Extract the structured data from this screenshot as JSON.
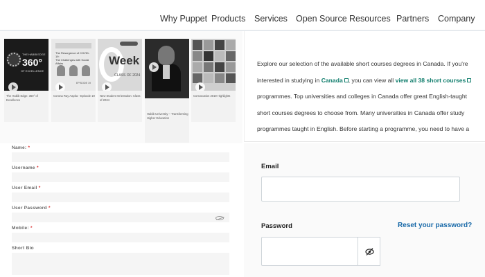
{
  "nav": {
    "items": [
      "Why Puppet",
      "Products",
      "Services",
      "Open Source",
      "Resources",
      "Partners",
      "Company"
    ]
  },
  "videos": [
    {
      "caption": "The Habib Edge: 360° of Excellence",
      "thumb_text": [
        "THE HABIB EDGE",
        "360°",
        "OF EXCELLENCE"
      ]
    },
    {
      "caption": "Corona Ray Aapka - Episode 19",
      "thumb_text": [
        "The Resurgence of COVID-19:",
        "The Challenges with Social Affairs",
        "EPISODE 19"
      ]
    },
    {
      "caption": "New Student Orientation: Class of 2024",
      "thumb_text": [
        "Week",
        "CLASS OF 2024"
      ]
    },
    {
      "caption": "Habib University – Transforming Higher Education"
    },
    {
      "caption": "Convocation 2019 Highlights"
    }
  ],
  "intro": {
    "text_a": "Explore our selection of the available short courses degrees in Canada. If you're interested in studying in ",
    "link_country": "Canada",
    "text_b": ", you can view all ",
    "link_view_all": "view all 38 short courses",
    "text_c": " programmes. Top universities and colleges in Canada offer great English-taught short courses degrees to choose from. Many universities in Canada offer study programmes taught in English. Before starting a programme, you need to have a basic knowledge of the English language."
  },
  "register": {
    "name_label": "Name:",
    "username_label": "Username",
    "email_label": "User Email",
    "password_label": "User Password",
    "mobile_label": "Mobile:",
    "bio_label": "Short Bio",
    "required_mark": "*"
  },
  "login": {
    "email_label": "Email",
    "password_label": "Password",
    "reset_link": "Reset your password?"
  },
  "colors": {
    "link_green": "#0e7c6b",
    "link_blue": "#1869a8",
    "required_red": "#dd3333"
  },
  "icons": [
    "play-icon",
    "external-link-icon",
    "eye-slash-icon"
  ]
}
